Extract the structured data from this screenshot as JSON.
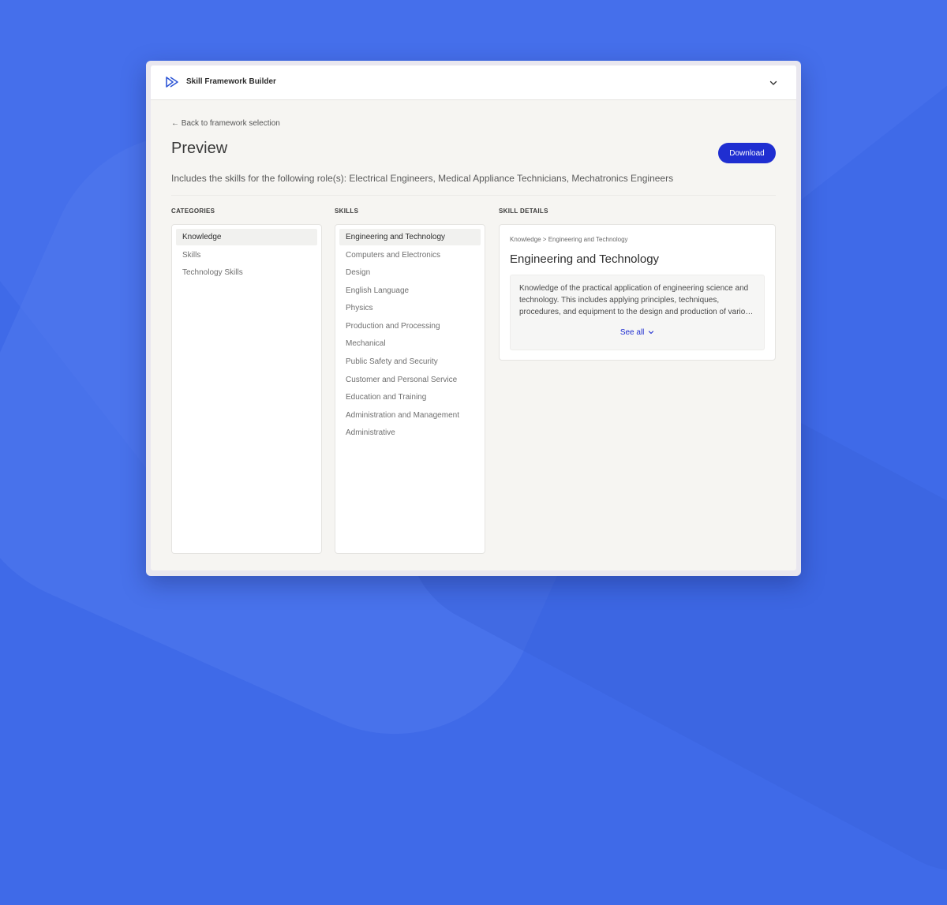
{
  "colors": {
    "background": "#3f6ae8",
    "accent": "#1f2ed1",
    "logo": "#2f57d6",
    "window": "#f6f5f2"
  },
  "header": {
    "app_title": "Skill Framework Builder",
    "logo_icon": "play-outline-logo",
    "menu_icon": "chevron-down-icon"
  },
  "page": {
    "back_link": "← Back to framework selection",
    "title": "Preview",
    "download_label": "Download",
    "roles_text": "Includes the skills for the following role(s): Electrical Engineers, Medical Appliance Technicians, Mechatronics Engineers"
  },
  "categories": {
    "label": "CATEGORIES",
    "items": [
      "Knowledge",
      "Skills",
      "Technology Skills"
    ],
    "selected": "Knowledge"
  },
  "skills": {
    "label": "SKILLS",
    "items": [
      "Engineering and Technology",
      "Computers and Electronics",
      "Design",
      "English Language",
      "Physics",
      "Production and Processing",
      "Mechanical",
      "Public Safety and Security",
      "Customer and Personal Service",
      "Education and Training",
      "Administration and Management",
      "Administrative"
    ],
    "selected": "Engineering and Technology"
  },
  "details": {
    "label": "SKILL DETAILS",
    "breadcrumb": "Knowledge > Engineering and Technology",
    "title": "Engineering and Technology",
    "description": "Knowledge of the practical application of engineering science and technology. This includes applying principles, techniques, procedures, and equipment to the design and production of various goods and services.",
    "see_all": "See all"
  }
}
